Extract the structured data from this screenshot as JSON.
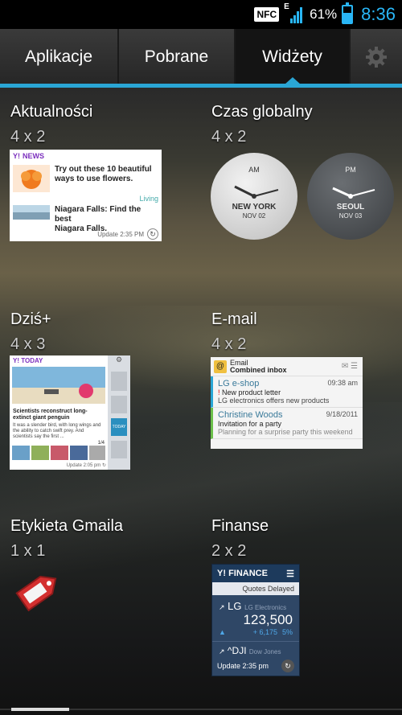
{
  "status": {
    "nfc": "NFC",
    "network": "E",
    "battery": "61%",
    "battery_level": 0.61,
    "time": "8:36"
  },
  "tabs": [
    {
      "label": "Aplikacje"
    },
    {
      "label": "Pobrane"
    },
    {
      "label": "Widżety"
    }
  ],
  "settings_icon": "gear-icon",
  "widgets": [
    {
      "title": "Aktualności",
      "size": "4 x 2",
      "preview": {
        "brand": "NEWS",
        "headline1": "Try out these 10 beautiful ways to use flowers.",
        "category": "Living",
        "headline2": "Niagara Falls: Find the best",
        "headline2b": "Niagara Falls.",
        "update": "Update 2:35 PM"
      }
    },
    {
      "title": "Czas globalny",
      "size": "4 x 2",
      "preview": {
        "clocks": [
          {
            "ampm": "AM",
            "city": "NEW YORK",
            "date": "NOV 02"
          },
          {
            "ampm": "PM",
            "city": "SEOUL",
            "date": "NOV 03"
          }
        ]
      }
    },
    {
      "title": "Dziś+",
      "size": "4 x 3",
      "preview": {
        "brand": "TODAY",
        "headline": "Scientists reconstruct long-extinct giant penguin",
        "body": "It was a slender bird, with long wings and the ability to catch swift prey. And scientists say the first ...",
        "page": "1/4",
        "update": "Update 2:05 pm",
        "side_label": "TODAY"
      }
    },
    {
      "title": "E-mail",
      "size": "4 x 2",
      "preview": {
        "app": "Email",
        "inbox": "Combined inbox",
        "rows": [
          {
            "from": "LG e-shop",
            "time": "09:38 am",
            "subject": "New product letter",
            "snippet": "LG electronics offers new products"
          },
          {
            "from": "Christine Woods",
            "time": "9/18/2011",
            "subject": "Invitation for a party",
            "snippet": "Planning for a surprise party this weekend"
          }
        ]
      }
    },
    {
      "title": "Etykieta Gmaila",
      "size": "1 x 1",
      "preview": {
        "icon": "gmail-label-tag-icon"
      }
    },
    {
      "title": "Finanse",
      "size": "2 x 2",
      "preview": {
        "brand": "FINANCE",
        "sub": "Quotes Delayed",
        "quote1_symbol": "LG",
        "quote1_name": "LG Electronics",
        "quote1_value": "123,500",
        "quote1_change": "+ 6,175",
        "quote1_pct": "5%",
        "quote2_symbol": "^DJI",
        "quote2_name": "Dow Jones",
        "update": "Update 2:35 pm"
      }
    }
  ],
  "colors": {
    "accent": "#2aa6d5",
    "clock": "#29b6f6",
    "yahoo_purple": "#7b2fbe"
  }
}
